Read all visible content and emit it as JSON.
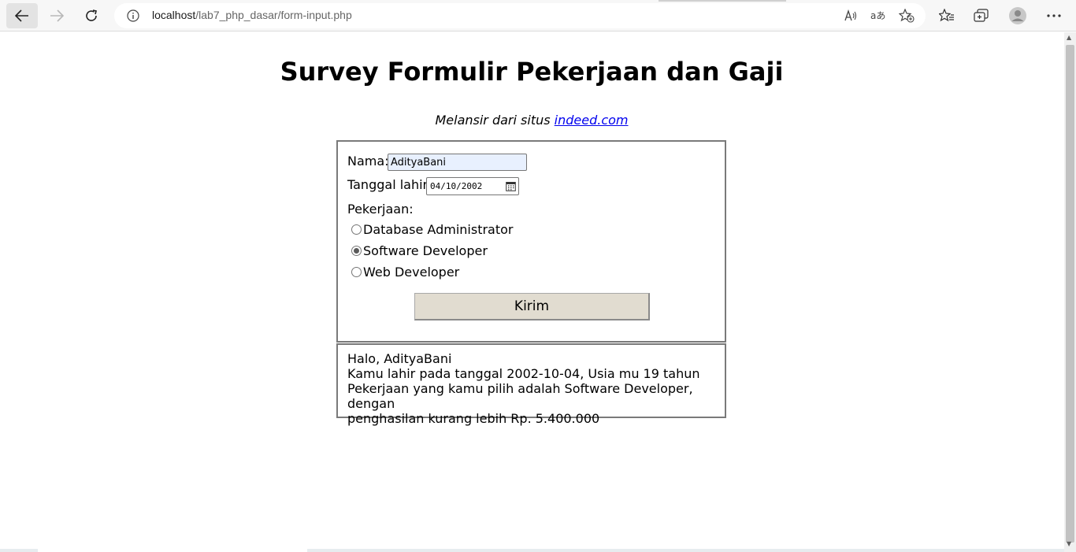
{
  "browser": {
    "url_host": "localhost",
    "url_path": "/lab7_php_dasar/form-input.php"
  },
  "page": {
    "title": "Survey Formulir Pekerjaan dan Gaji",
    "source_prefix": "Melansir dari situs",
    "source_link": "indeed.com"
  },
  "form": {
    "nama_label": "Nama:",
    "nama_value": "AdityaBani",
    "tanggal_label": "Tanggal lahir:",
    "tanggal_value": "04/10/2002",
    "pekerjaan_label": "Pekerjaan:",
    "options": [
      "Database Administrator",
      "Software Developer",
      "Web Developer"
    ],
    "selected": "Software Developer",
    "submit_label": "Kirim"
  },
  "result": {
    "line1": "Halo, AdityaBani",
    "line2": "Kamu lahir pada tanggal 2002-10-04, Usia mu 19 tahun",
    "line3": "Pekerjaan yang kamu pilih adalah Software Developer, dengan",
    "line4": "penghasilan kurang lebih Rp. 5.400.000"
  }
}
